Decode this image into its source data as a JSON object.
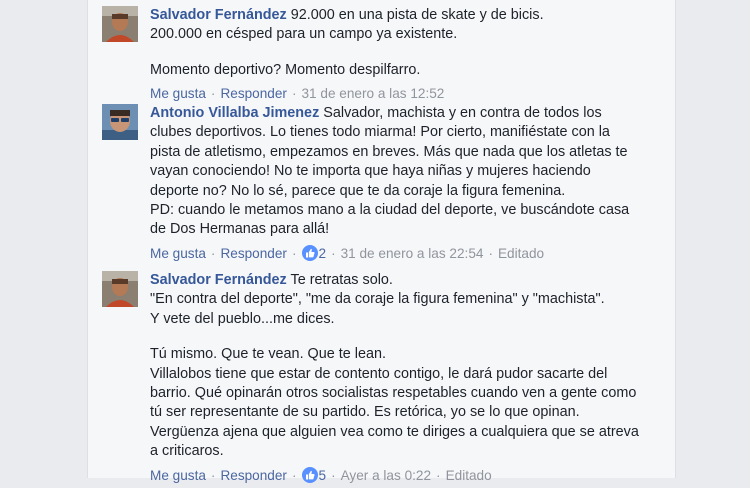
{
  "comments": [
    {
      "author": "Salvador Fernández",
      "paragraphs": [
        [
          "92.000 en una pista de skate y de bicis.",
          "200.000 en césped para un campo ya existente."
        ],
        [
          "Momento deportivo? Momento despilfarro."
        ]
      ],
      "like_label": "Me gusta",
      "reply_label": "Responder",
      "timestamp": "31 de enero a las 12:52"
    },
    {
      "author": "Antonio Villalba Jimenez",
      "paragraphs": [
        [
          "Salvador, machista y en contra de todos los clubes deportivos. Lo tienes todo miarma! Por cierto, manifiéstate con la pista de atletismo, empezamos en breves. Más que nada que los atletas te vayan conociendo! No te importa que haya niñas y mujeres haciendo deporte no? No lo sé, parece que te da coraje la figura femenina.",
          "PD: cuando le metamos mano a la ciudad del deporte, ve buscándote casa de Dos Hermanas para allá!"
        ]
      ],
      "like_label": "Me gusta",
      "reply_label": "Responder",
      "reactions": "2",
      "timestamp": "31 de enero a las 22:54",
      "edited_label": "Editado"
    },
    {
      "author": "Salvador Fernández",
      "paragraphs": [
        [
          "Te retratas solo.",
          "\"En contra del deporte\", \"me da coraje la figura femenina\" y \"machista\".",
          "Y vete del pueblo...me dices."
        ],
        [
          "Tú mismo. Que te vean. Que te lean.",
          "Villalobos tiene que estar de contento contigo, le dará pudor sacarte del barrio. Qué opinarán otros socialistas respetables cuando ven a gente como tú ser representante de su partido. Es retórica, yo se lo que opinan.",
          "Vergüenza ajena que alguien vea como te diriges a cualquiera que se atreva a criticaros."
        ]
      ],
      "like_label": "Me gusta",
      "reply_label": "Responder",
      "reactions": "5",
      "timestamp": "Ayer a las 0:22",
      "edited_label": "Editado"
    }
  ],
  "colors": {
    "author": "#365899",
    "text": "#1d2129",
    "meta": "#90949c",
    "link": "#4b67a1",
    "like_blue": "#5890ff"
  },
  "icons": {
    "reaction": "like-thumb-icon"
  }
}
